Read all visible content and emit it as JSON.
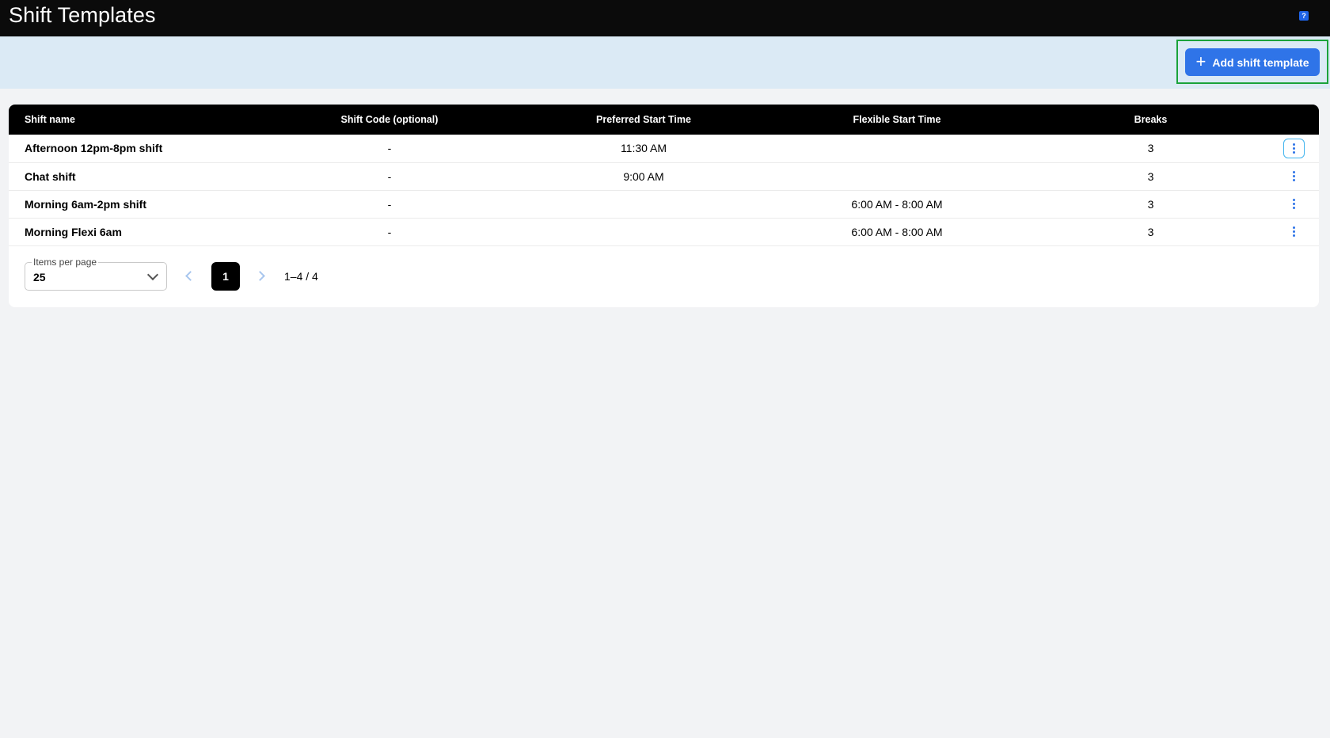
{
  "header": {
    "title": "Shift Templates",
    "help_icon": "help-icon",
    "help_glyph": "?"
  },
  "toolbar": {
    "add_label": "Add shift template",
    "add_icon": "plus-icon",
    "add_glyph": "+",
    "accent_color": "#2f74e8",
    "highlight_color": "#1aa33a"
  },
  "table": {
    "columns": [
      "Shift name",
      "Shift Code (optional)",
      "Preferred Start Time",
      "Flexible Start Time",
      "Breaks"
    ],
    "rows": [
      {
        "name": "Afternoon 12pm-8pm shift",
        "code": "-",
        "preferred": "11:30 AM",
        "flexible": "",
        "breaks": "3"
      },
      {
        "name": "Chat shift",
        "code": "-",
        "preferred": "9:00 AM",
        "flexible": "",
        "breaks": "3"
      },
      {
        "name": "Morning 6am-2pm shift",
        "code": "-",
        "preferred": "",
        "flexible": "6:00 AM - 8:00 AM",
        "breaks": "3"
      },
      {
        "name": "Morning Flexi 6am",
        "code": "-",
        "preferred": "",
        "flexible": "6:00 AM - 8:00 AM",
        "breaks": "3"
      }
    ],
    "row_action_icon": "more-vertical-icon"
  },
  "pagination": {
    "items_per_page_label": "Items per page",
    "items_per_page_value": "25",
    "current_page": "1",
    "range": "1–4 / 4"
  }
}
